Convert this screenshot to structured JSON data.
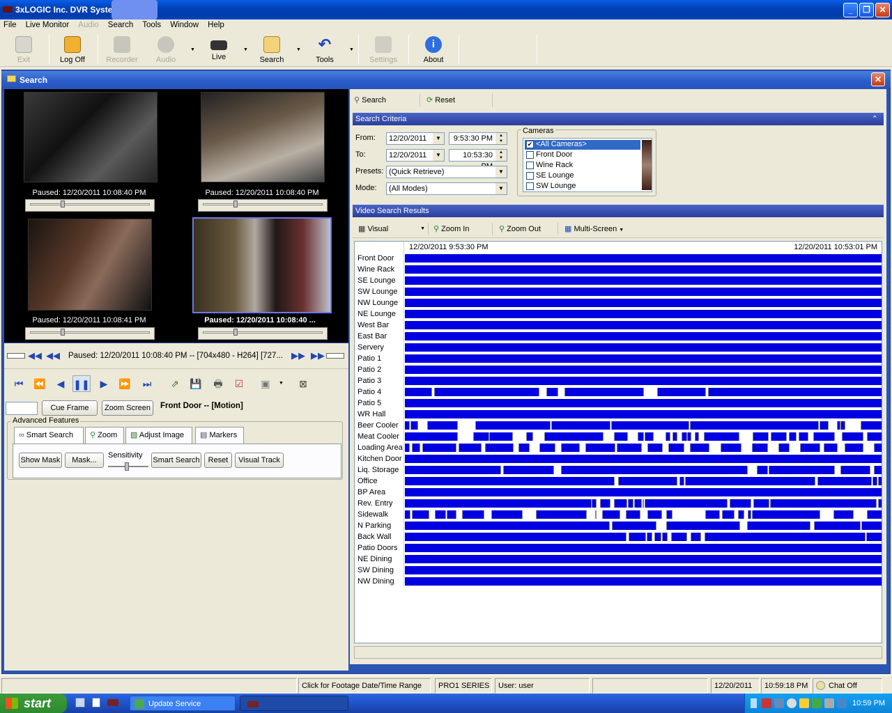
{
  "app": {
    "title": "3xLOGIC Inc. DVR System"
  },
  "window_buttons": {
    "minimize": "_",
    "maximize": "❐",
    "close": "✕"
  },
  "menu": [
    "File",
    "Live Monitor",
    "Audio",
    "Search",
    "Tools",
    "Window",
    "Help"
  ],
  "toolbar": {
    "exit": "Exit",
    "logoff": "Log Off",
    "recorder": "Recorder",
    "audio": "Audio",
    "live": "Live",
    "search": "Search",
    "tools": "Tools",
    "settings": "Settings",
    "about": "About"
  },
  "search_window": {
    "title": "Search"
  },
  "video": {
    "cap1": "Paused: 12/20/2011 10:08:40 PM",
    "cap2": "Paused: 12/20/2011 10:08:40 PM",
    "cap3": "Paused: 12/20/2011 10:08:41 PM",
    "cap4": "Paused: 12/20/2011 10:08:40 ..."
  },
  "playback": {
    "status": "Paused: 12/20/2011 10:08:40 PM  --  [704x480 - H264]  [727...",
    "cue_frame": "Cue Frame",
    "zoom_screen": "Zoom Screen",
    "camera_label": "Front Door -- [Motion]",
    "cue_value": ""
  },
  "advanced": {
    "title": "Advanced Features",
    "tabs": [
      "Smart Search",
      "Zoom",
      "Adjust Image",
      "Markers"
    ],
    "show_mask": "Show Mask",
    "mask": "Mask...",
    "sensitivity": "Sensitivity",
    "smart_search": "Smart Search",
    "reset": "Reset",
    "visual_track": "Visual Track"
  },
  "right_toolbar": {
    "search": "Search",
    "reset": "Reset"
  },
  "criteria": {
    "title": "Search Criteria",
    "from_label": "From:",
    "to_label": "To:",
    "presets_label": "Presets:",
    "mode_label": "Mode:",
    "from_date": "12/20/2011",
    "from_time": "9:53:30 PM",
    "to_date": "12/20/2011",
    "to_time": "10:53:30 PM",
    "presets": "(Quick Retrieve)",
    "mode": "(All Modes)",
    "cameras_title": "Cameras",
    "cameras": [
      "<All Cameras>",
      "Front Door",
      "Wine Rack",
      "SE Lounge",
      "SW Lounge"
    ]
  },
  "results": {
    "title": "Video Search Results",
    "visual": "Visual",
    "zoom_in": "Zoom In",
    "zoom_out": "Zoom Out",
    "multi_screen": "Multi-Screen",
    "start_time": "12/20/2011 9:53:30 PM",
    "end_time": "12/20/2011 10:53:01 PM"
  },
  "timeline_rows": [
    {
      "name": "Front Door",
      "gaps": []
    },
    {
      "name": "Wine Rack",
      "gaps": []
    },
    {
      "name": "SE Lounge",
      "gaps": []
    },
    {
      "name": "SW Lounge",
      "gaps": []
    },
    {
      "name": "NW Lounge",
      "gaps": []
    },
    {
      "name": "NE Lounge",
      "gaps": []
    },
    {
      "name": "West Bar",
      "gaps": []
    },
    {
      "name": "East Bar",
      "gaps": []
    },
    {
      "name": "Servery",
      "gaps": []
    },
    {
      "name": "Patio 1",
      "gaps": []
    },
    {
      "name": "Patio 2",
      "gaps": []
    },
    {
      "name": "Patio 3",
      "gaps": []
    },
    {
      "name": "Patio 4",
      "gaps": [
        [
          0.056,
          0.063
        ],
        [
          0.28,
          0.298
        ],
        [
          0.32,
          0.336
        ],
        [
          0.5,
          0.53
        ],
        [
          0.63,
          0.638
        ]
      ]
    },
    {
      "name": "Patio 5",
      "gaps": []
    },
    {
      "name": "WR Hall",
      "gaps": []
    },
    {
      "name": "Beer Cooler",
      "gaps": [
        [
          0.009,
          0.013
        ],
        [
          0.026,
          0.048
        ],
        [
          0.11,
          0.149
        ],
        [
          0.304,
          0.309
        ],
        [
          0.43,
          0.435
        ],
        [
          0.595,
          0.6
        ],
        [
          0.867,
          0.871
        ],
        [
          0.888,
          0.908
        ],
        [
          0.913,
          0.916
        ],
        [
          0.923,
          0.958
        ]
      ]
    },
    {
      "name": "Meat Cooler",
      "gaps": [
        [
          0.11,
          0.145
        ],
        [
          0.175,
          0.178
        ],
        [
          0.225,
          0.255
        ],
        [
          0.268,
          0.295
        ],
        [
          0.415,
          0.44
        ],
        [
          0.467,
          0.49
        ],
        [
          0.5,
          0.505
        ],
        [
          0.52,
          0.548
        ],
        [
          0.555,
          0.562
        ],
        [
          0.57,
          0.582
        ],
        [
          0.59,
          0.593
        ],
        [
          0.6,
          0.61
        ],
        [
          0.615,
          0.628
        ],
        [
          0.7,
          0.73
        ],
        [
          0.762,
          0.77
        ],
        [
          0.8,
          0.808
        ],
        [
          0.82,
          0.827
        ],
        [
          0.845,
          0.858
        ],
        [
          0.9,
          0.918
        ],
        [
          0.96,
          0.97
        ]
      ]
    },
    {
      "name": "Loading Area",
      "gaps": [
        [
          0.009,
          0.016
        ],
        [
          0.03,
          0.038
        ],
        [
          0.107,
          0.115
        ],
        [
          0.16,
          0.17
        ],
        [
          0.227,
          0.24
        ],
        [
          0.26,
          0.283
        ],
        [
          0.315,
          0.33
        ],
        [
          0.365,
          0.38
        ],
        [
          0.44,
          0.446
        ],
        [
          0.495,
          0.51
        ],
        [
          0.54,
          0.555
        ],
        [
          0.585,
          0.6
        ],
        [
          0.637,
          0.663
        ],
        [
          0.705,
          0.73
        ],
        [
          0.76,
          0.785
        ],
        [
          0.805,
          0.83
        ],
        [
          0.87,
          0.88
        ],
        [
          0.907,
          0.925
        ],
        [
          0.96,
          0.985
        ]
      ]
    },
    {
      "name": "Kitchen Door",
      "gaps": []
    },
    {
      "name": "Liq. Storage",
      "gaps": [
        [
          0.2,
          0.208
        ],
        [
          0.312,
          0.33
        ],
        [
          0.718,
          0.74
        ],
        [
          0.76,
          0.765
        ],
        [
          0.9,
          0.915
        ],
        [
          0.975,
          0.985
        ]
      ]
    },
    {
      "name": "Office",
      "gaps": [
        [
          0.438,
          0.448
        ],
        [
          0.57,
          0.578
        ],
        [
          0.585,
          0.59
        ],
        [
          0.86,
          0.868
        ],
        [
          0.978,
          0.983
        ],
        [
          0.99,
          0.995
        ]
      ]
    },
    {
      "name": "BP Area",
      "gaps": []
    },
    {
      "name": "Rev. Entry",
      "gaps": [
        [
          0.39,
          0.393
        ],
        [
          0.4,
          0.41
        ],
        [
          0.43,
          0.44
        ],
        [
          0.465,
          0.47
        ],
        [
          0.478,
          0.482
        ],
        [
          0.495,
          0.5
        ],
        [
          0.5,
          0.505
        ],
        [
          0.676,
          0.684
        ],
        [
          0.725,
          0.733
        ],
        [
          0.763,
          0.768
        ],
        [
          0.988,
          0.994
        ]
      ]
    },
    {
      "name": "Sidewalk",
      "gaps": [
        [
          0.01,
          0.016
        ],
        [
          0.05,
          0.065
        ],
        [
          0.085,
          0.09
        ],
        [
          0.106,
          0.12
        ],
        [
          0.165,
          0.183
        ],
        [
          0.245,
          0.275
        ],
        [
          0.38,
          0.4
        ],
        [
          0.4,
          0.415
        ],
        [
          0.45,
          0.465
        ],
        [
          0.493,
          0.51
        ],
        [
          0.538,
          0.55
        ],
        [
          0.56,
          0.632
        ],
        [
          0.66,
          0.667
        ],
        [
          0.69,
          0.7
        ],
        [
          0.71,
          0.72
        ],
        [
          0.725,
          0.73
        ],
        [
          0.87,
          0.9
        ],
        [
          0.94,
          0.97
        ]
      ]
    },
    {
      "name": "N Parking",
      "gaps": [
        [
          0.428,
          0.436
        ],
        [
          0.527,
          0.55
        ],
        [
          0.702,
          0.72
        ],
        [
          0.85,
          0.86
        ],
        [
          0.955,
          0.96
        ]
      ]
    },
    {
      "name": "Back Wall",
      "gaps": [
        [
          0.463,
          0.47
        ],
        [
          0.505,
          0.51
        ],
        [
          0.518,
          0.525
        ],
        [
          0.536,
          0.54
        ],
        [
          0.55,
          0.56
        ],
        [
          0.59,
          0.6
        ],
        [
          0.62,
          0.63
        ],
        [
          0.965,
          0.97
        ]
      ]
    },
    {
      "name": "Patio Doors",
      "gaps": []
    },
    {
      "name": "NE Dining",
      "gaps": []
    },
    {
      "name": "SW Dining",
      "gaps": []
    },
    {
      "name": "NW Dining",
      "gaps": []
    }
  ],
  "status": {
    "footage_hint": "Click for Footage Date/Time Range",
    "series": "PRO1 SERIES",
    "user": "User: user",
    "date": "12/20/2011",
    "time": "10:59:18 PM",
    "chat": "Chat Off"
  },
  "taskbar": {
    "start": "start",
    "task1": "Update Service",
    "clock": "10:59 PM"
  },
  "colors": {
    "timeline_blue": "#0000e0",
    "accent": "#2b55b5"
  }
}
